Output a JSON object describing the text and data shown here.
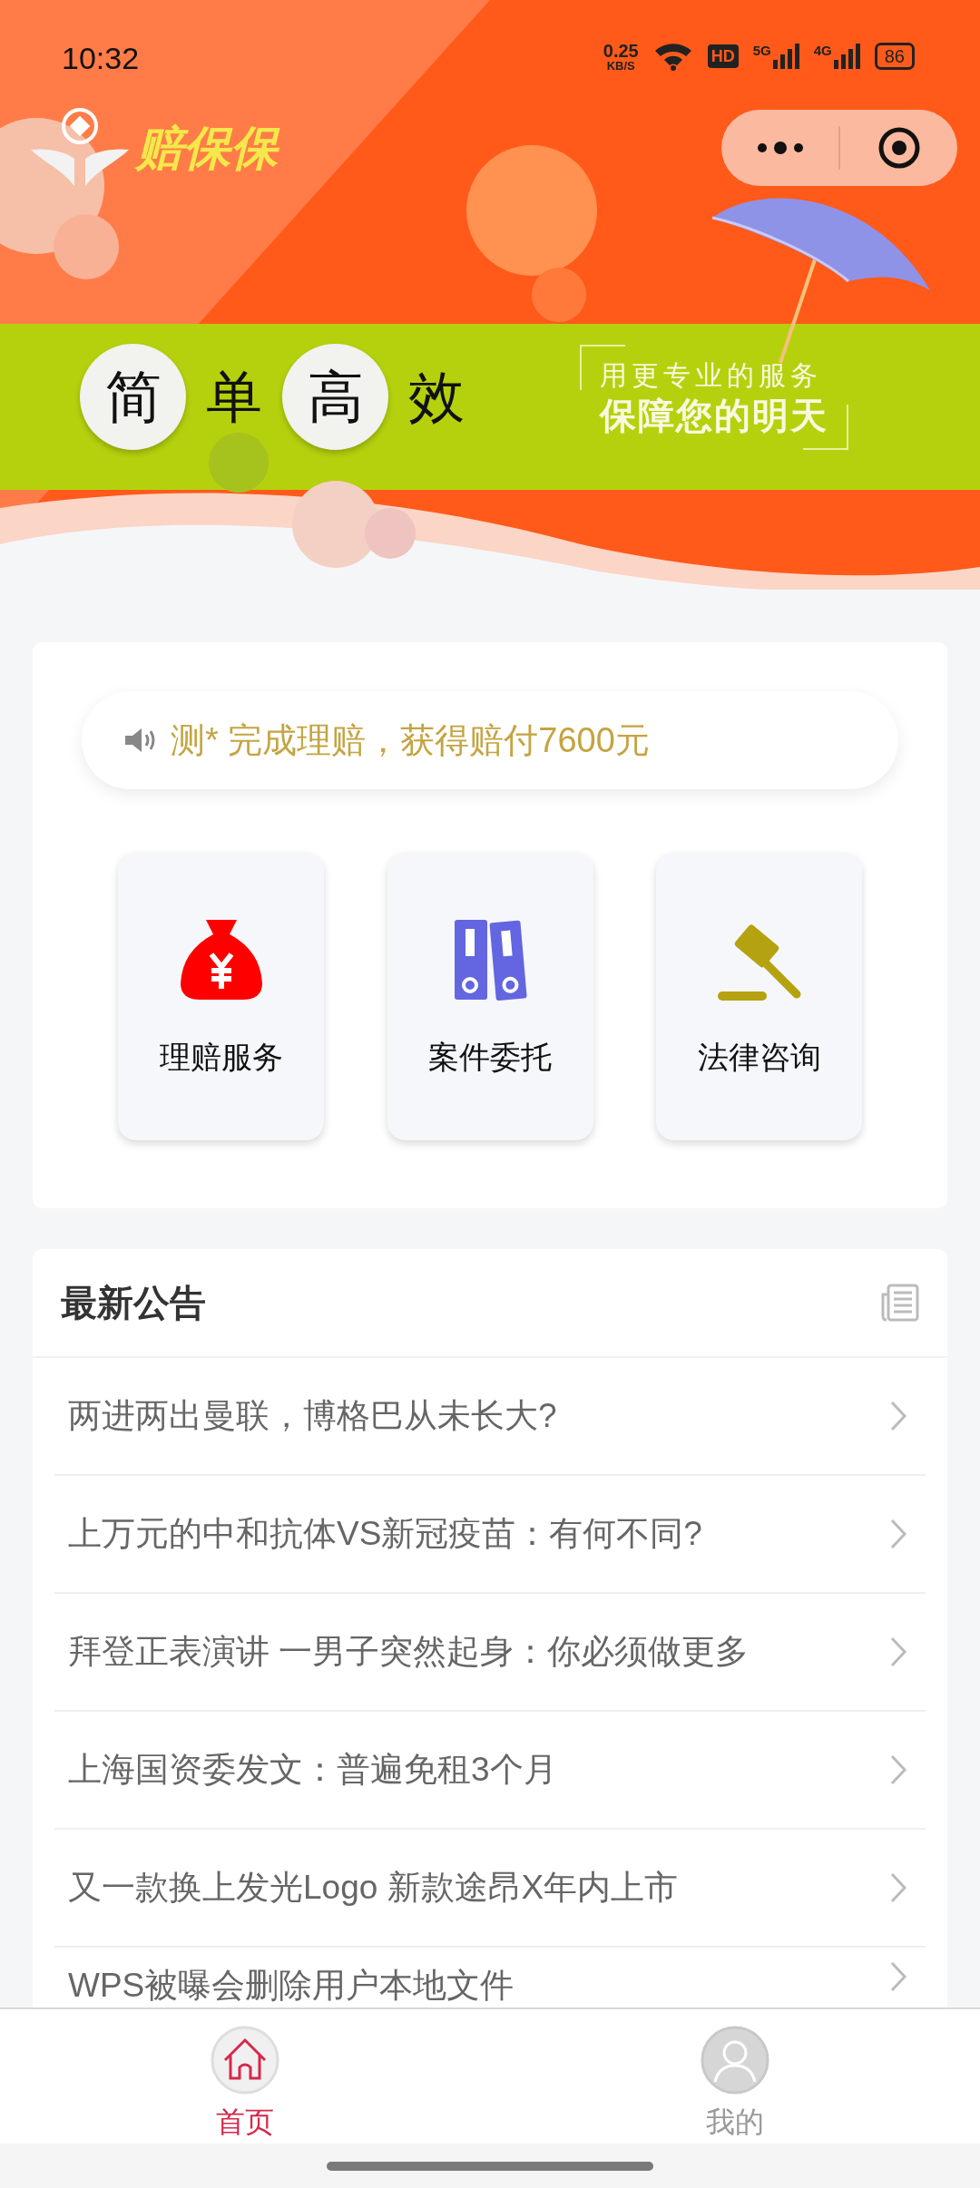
{
  "status_bar": {
    "time": "10:32",
    "net_speed": "0.25",
    "net_unit": "KB/S",
    "hd": "HD",
    "signal_1": "5G",
    "signal_2": "4G",
    "battery": "86"
  },
  "header": {
    "logo_text": "赔保保"
  },
  "banner": {
    "slogan": [
      {
        "char": "简",
        "circled": true
      },
      {
        "char": "单",
        "circled": false
      },
      {
        "char": "高",
        "circled": true
      },
      {
        "char": "效",
        "circled": false
      }
    ],
    "tagline": [
      "用更专业的服务",
      "保障您的明天"
    ]
  },
  "notice": "测* 完成理赔，获得赔付7600元",
  "services": [
    {
      "label": "理赔服务",
      "kind": "money-bag"
    },
    {
      "label": "案件委托",
      "kind": "binders"
    },
    {
      "label": "法律咨询",
      "kind": "gavel"
    }
  ],
  "announcements": {
    "title": "最新公告",
    "items": [
      "两进两出曼联，博格巴从未长大?",
      "上万元的中和抗体VS新冠疫苗：有何不同?",
      "拜登正表演讲 一男子突然起身：你必须做更多",
      "上海国资委发文：普遍免租3个月",
      "又一款换上发光Logo 新款途昂X年内上市",
      "WPS被曝会删除用户本地文件"
    ]
  },
  "tabs": [
    {
      "label": "首页",
      "kind": "home",
      "selected": true
    },
    {
      "label": "我的",
      "kind": "user",
      "selected": false
    }
  ]
}
